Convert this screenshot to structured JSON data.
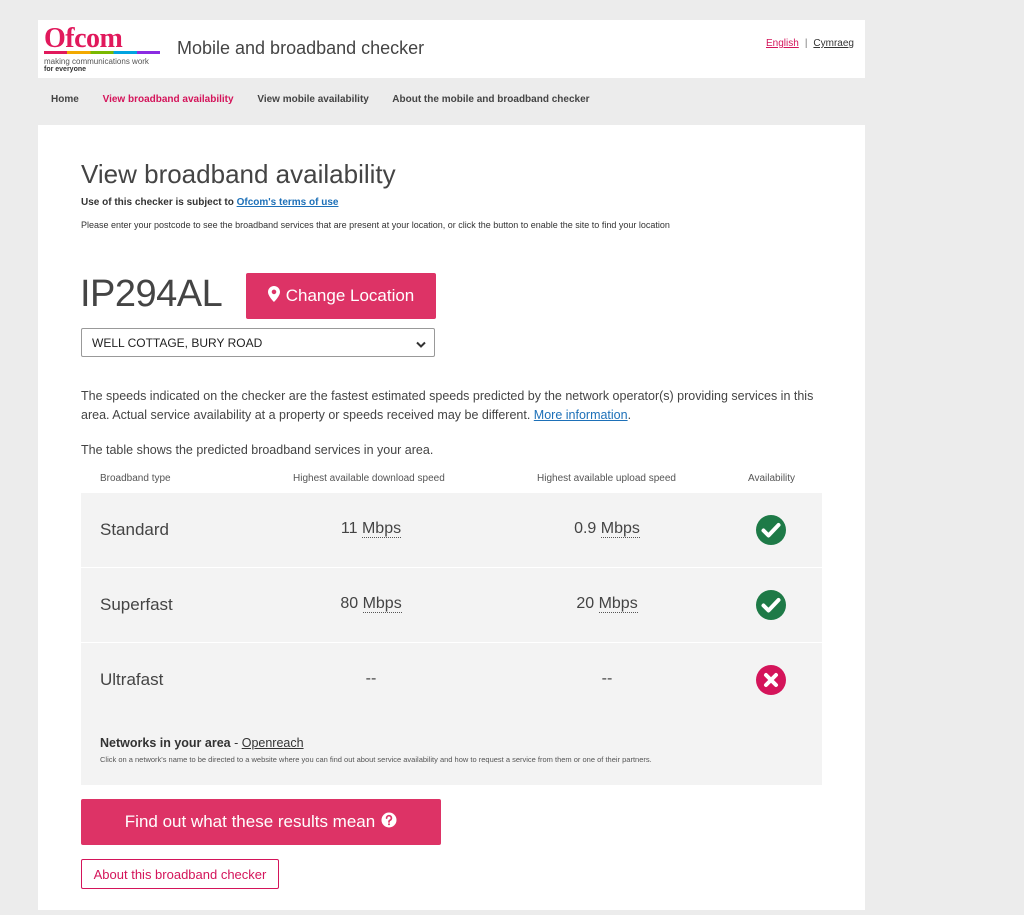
{
  "header": {
    "logo_text": "Ofcom",
    "logo_tagline": "making communications work",
    "logo_tagline2": "for everyone",
    "site_title": "Mobile and broadband checker",
    "lang_english": "English",
    "lang_separator": "|",
    "lang_welsh": "Cymraeg"
  },
  "nav": {
    "items": [
      {
        "label": "Home"
      },
      {
        "label": "View broadband availability"
      },
      {
        "label": "View mobile availability"
      },
      {
        "label": "About the mobile and broadband checker"
      }
    ],
    "active_index": 1
  },
  "main": {
    "title": "View broadband availability",
    "terms_prefix": "Use of this checker is subject to ",
    "terms_link": "Ofcom's terms of use",
    "instructions": "Please enter your postcode to see the broadband services that are present at your location, or click the button to enable the site to find your location",
    "postcode": "IP294AL",
    "change_location_label": "Change Location",
    "address_selected": "WELL COTTAGE, BURY ROAD",
    "disclaimer": "The speeds indicated on the checker are the fastest estimated speeds predicted by the network operator(s) providing services in this area. Actual service availability at a property or speeds received may be different. ",
    "more_info_link": "More information",
    "disclaimer_end": ".",
    "table_intro": "The table shows the predicted broadband services in your area."
  },
  "table": {
    "headers": {
      "type": "Broadband type",
      "download": "Highest available download speed",
      "upload": "Highest available upload speed",
      "availability": "Availability"
    },
    "rows": [
      {
        "type": "Standard",
        "download_value": "11",
        "download_unit": "Mbps",
        "upload_value": "0.9",
        "upload_unit": "Mbps",
        "available": true
      },
      {
        "type": "Superfast",
        "download_value": "80",
        "download_unit": "Mbps",
        "upload_value": "20",
        "upload_unit": "Mbps",
        "available": true
      },
      {
        "type": "Ultrafast",
        "download_value": "--",
        "download_unit": "",
        "upload_value": "--",
        "upload_unit": "",
        "available": false
      }
    ],
    "networks_label": "Networks in your area",
    "networks_separator": " - ",
    "network_link": "Openreach",
    "networks_note": "Click on a network's name to be directed to a website where you can find out about service availability and how to request a service from them or one of their partners."
  },
  "buttons": {
    "results_label": "Find out what these results mean",
    "about_label": "About this broadband checker"
  },
  "colors": {
    "brand": "#dd3366",
    "available": "#1e7a47",
    "unavailable": "#d4145a",
    "link": "#1d70b8"
  }
}
